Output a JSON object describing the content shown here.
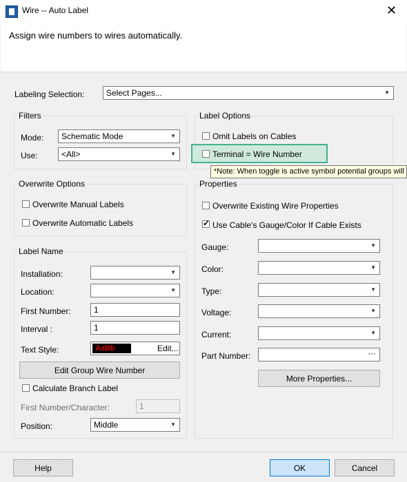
{
  "window": {
    "title": "Wire -- Auto Label",
    "close_glyph": "✕"
  },
  "header": {
    "description": "Assign wire numbers to wires automatically."
  },
  "labeling": {
    "label": "Labeling Selection:",
    "value": "Select Pages..."
  },
  "filters": {
    "title": "Filters",
    "mode_label": "Mode:",
    "mode_value": "Schematic Mode",
    "use_label": "Use:",
    "use_value": "<All>"
  },
  "overwrite": {
    "title": "Overwrite Options",
    "manual_label": "Overwrite Manual Labels",
    "automatic_label": "Overwrite Automatic Labels"
  },
  "label_name": {
    "title": "Label Name",
    "installation_label": "Installation:",
    "installation_value": "",
    "location_label": "Location:",
    "location_value": "",
    "first_number_label": "First Number:",
    "first_number_value": "1",
    "interval_label": "Interval :",
    "interval_value": "1",
    "text_style_label": "Text Style:",
    "text_style_sample": "AaBb",
    "edit_label": "Edit...",
    "edit_group_button": "Edit Group Wire Number",
    "calc_branch_label": "Calculate Branch Label",
    "first_char_label": "First Number/Character:",
    "first_char_value": "1",
    "position_label": "Position:",
    "position_value": "Middle"
  },
  "label_options": {
    "title": "Label Options",
    "omit_cables_label": "Omit Labels on Cables",
    "terminal_label": "Terminal = Wire Number",
    "tooltip": "*Note: When toggle is active symbol potential groups will be used."
  },
  "properties": {
    "title": "Properties",
    "overwrite_existing_label": "Overwrite Existing Wire Properties",
    "use_cable_label": "Use Cable's Gauge/Color If Cable Exists",
    "use_cable_checked": true,
    "gauge_label": "Gauge:",
    "color_label": "Color:",
    "type_label": "Type:",
    "voltage_label": "Voltage:",
    "current_label": "Current:",
    "part_number_label": "Part Number:",
    "part_number_button": "···",
    "more_properties_button": "More Properties..."
  },
  "footer": {
    "help": "Help",
    "ok": "OK",
    "cancel": "Cancel"
  },
  "colors": {
    "highlight": "#44b291",
    "primary_button": "#0078d7"
  }
}
